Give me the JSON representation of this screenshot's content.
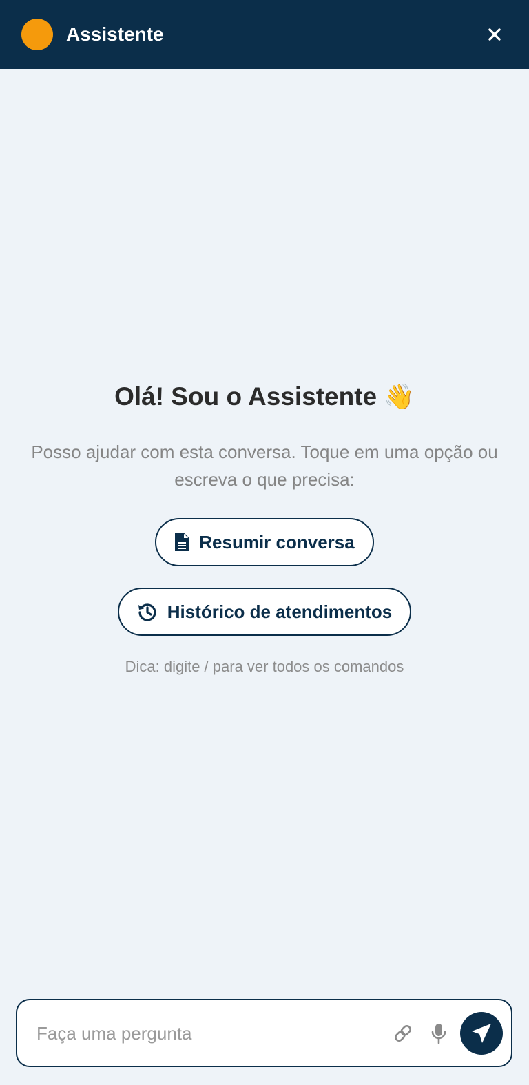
{
  "header": {
    "title": "Assistente",
    "avatar_color": "#f59a0c",
    "background": "#0b2e4a",
    "close_icon": "close-icon"
  },
  "welcome": {
    "heading": "Olá! Sou o Assistente",
    "emoji": "👋",
    "intro": "Posso ajudar com esta conversa. Toque em uma opção ou escreva o que precisa:",
    "actions": [
      {
        "label": "Resumir conversa",
        "icon": "document-icon"
      },
      {
        "label": "Histórico de atendimentos",
        "icon": "history-icon"
      }
    ],
    "tip": "Dica: digite / para ver todos os comandos"
  },
  "composer": {
    "placeholder": "Faça uma pergunta",
    "value": "",
    "attach_icon": "link-icon",
    "mic_icon": "microphone-icon",
    "send_icon": "send-icon"
  },
  "colors": {
    "primary": "#0b2e4a",
    "accent": "#f59a0c",
    "background": "#eef3f8"
  }
}
